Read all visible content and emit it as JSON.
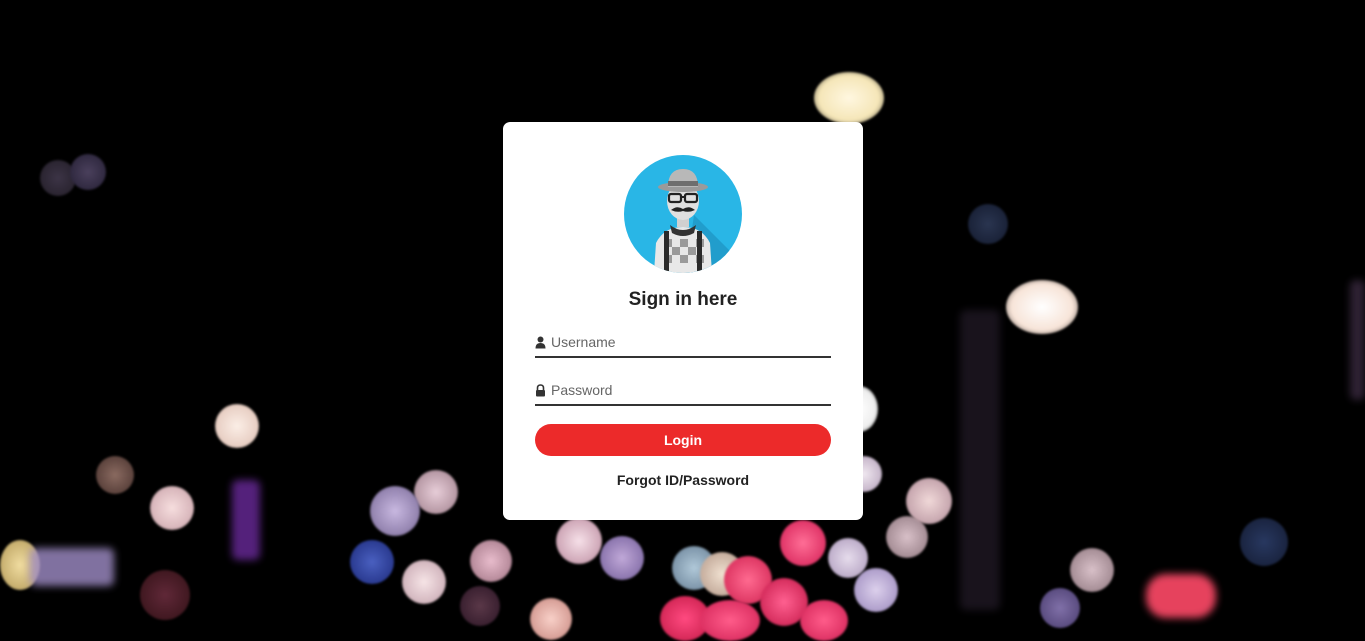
{
  "form": {
    "title": "Sign in here",
    "username": {
      "placeholder": "Username",
      "value": "",
      "icon": "user-icon"
    },
    "password": {
      "placeholder": "Password",
      "value": "",
      "icon": "lock-icon"
    },
    "login_label": "Login",
    "forgot_label": "Forgot ID/Password"
  },
  "avatar": {
    "icon": "hipster-avatar-icon"
  },
  "colors": {
    "accent": "#ec2a2a",
    "avatar_bg": "#29b6e6",
    "card_bg": "#ffffff",
    "page_bg": "#000000"
  }
}
